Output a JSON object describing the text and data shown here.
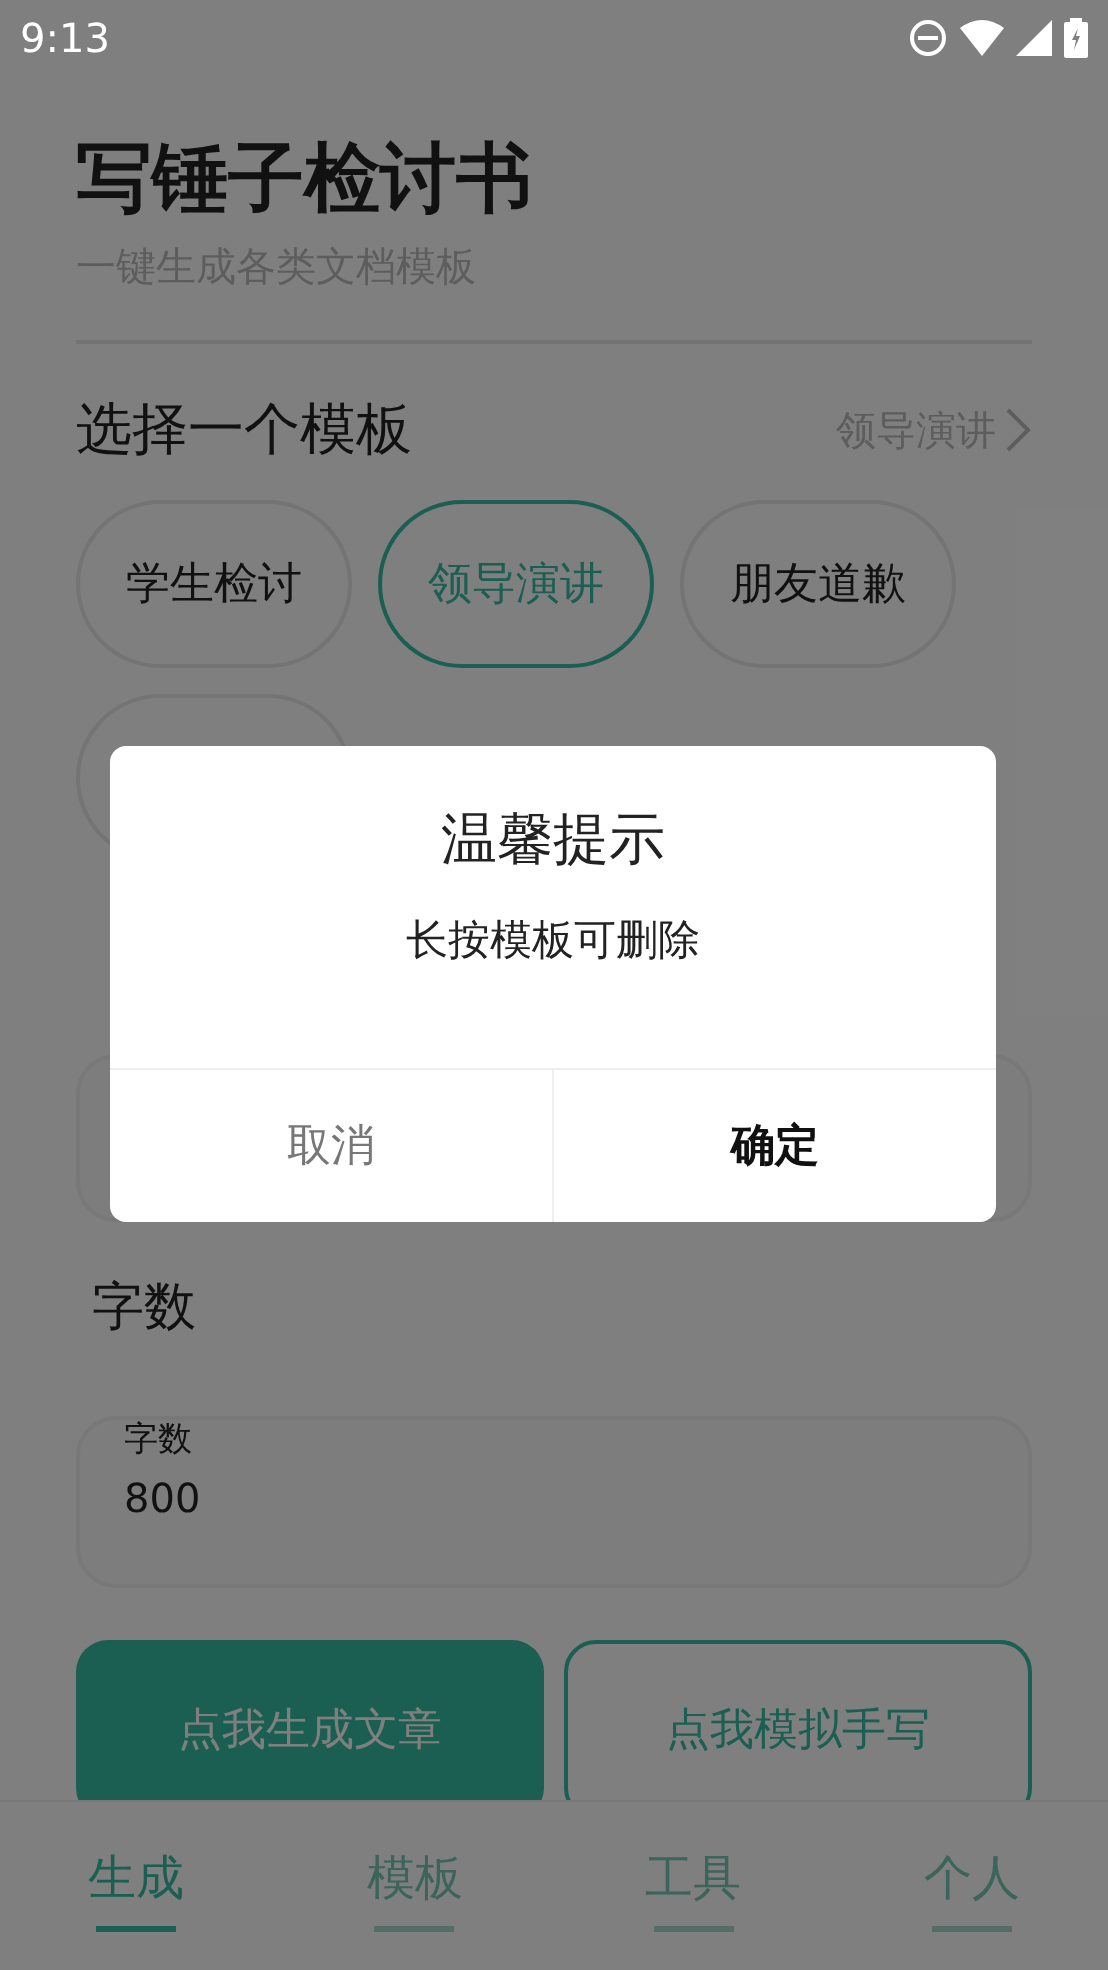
{
  "status_bar": {
    "time": "9:13"
  },
  "header": {
    "title": "写锤子检讨书",
    "subtitle": "一键生成各类文档模板"
  },
  "template_section": {
    "title": "选择一个模板",
    "current": "领导演讲",
    "chips": [
      {
        "label": "学生检讨",
        "selected": false
      },
      {
        "label": "领导演讲",
        "selected": true
      },
      {
        "label": "朋友道歉",
        "selected": false
      },
      {
        "selected": false
      }
    ]
  },
  "word_count": {
    "label": "字数",
    "field_label": "字数",
    "value": "800"
  },
  "actions": [
    {
      "label": "点我生成文章",
      "kind": "filled"
    },
    {
      "label": "点我模拟手写",
      "kind": "outline"
    }
  ],
  "bottom_nav": [
    {
      "label": "生成",
      "selected": true
    },
    {
      "label": "模板",
      "selected": false
    },
    {
      "label": "工具",
      "selected": false
    },
    {
      "label": "个人",
      "selected": false
    }
  ],
  "dialog": {
    "title": "温馨提示",
    "message": "长按模板可删除",
    "buttons": [
      {
        "label": "取消",
        "kind": "cancel"
      },
      {
        "label": "确定",
        "kind": "confirm"
      }
    ]
  }
}
